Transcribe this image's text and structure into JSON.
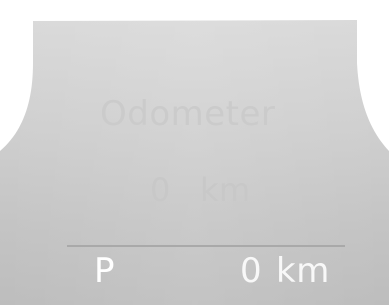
{
  "odometer": {
    "title": "Odometer",
    "value": "0",
    "unit": "km"
  },
  "trip": {
    "gear": "P",
    "value": "0",
    "unit": "km"
  },
  "colors": {
    "panel_top": "#d9d9d9",
    "panel_bottom": "#c3c3c3",
    "text_dim": "#c8c8c8",
    "text_bright": "#ffffff"
  }
}
